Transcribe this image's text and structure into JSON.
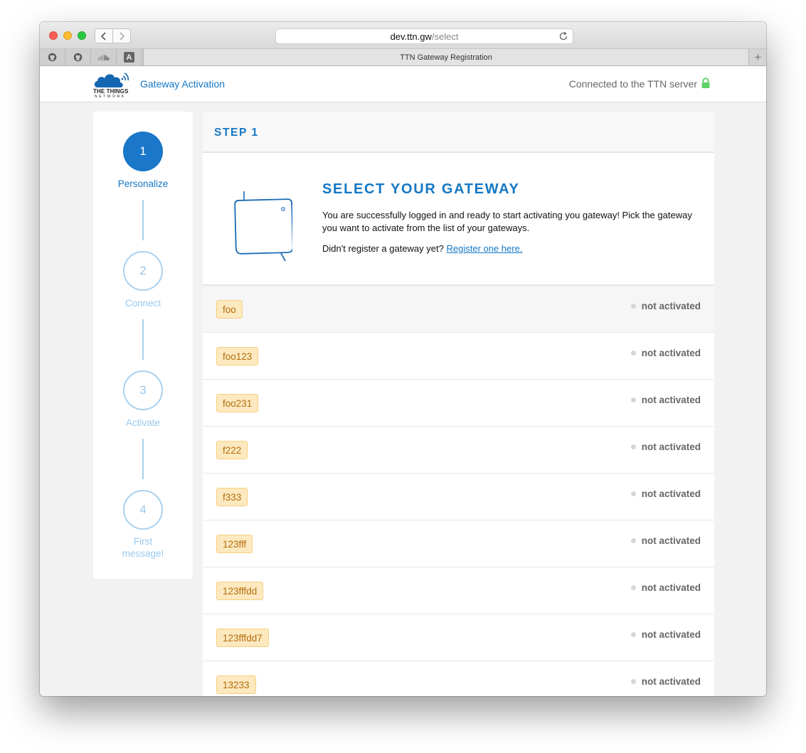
{
  "browser": {
    "url_host": "dev.ttn.gw",
    "url_path": "/select",
    "tab_title": "TTN Gateway Registration",
    "pinned_tabs": [
      "github-icon",
      "github-icon",
      "soundcloud-icon",
      "a-icon"
    ],
    "pinned_a_letter": "A"
  },
  "header": {
    "logo_line1": "THE THINGS",
    "logo_line2": "NETWORK",
    "app_title": "Gateway Activation",
    "connection_status": "Connected to the TTN server",
    "accent_color": "#1577c3",
    "lock_color": "#5fd26a"
  },
  "stepper": {
    "steps": [
      {
        "number": "1",
        "label": "Personalize",
        "active": true
      },
      {
        "number": "2",
        "label": "Connect",
        "active": false
      },
      {
        "number": "3",
        "label": "Activate",
        "active": false
      },
      {
        "number": "4",
        "label_line1": "First",
        "label_line2": "message!",
        "active": false
      }
    ]
  },
  "main": {
    "step_heading": "STEP 1",
    "title": "SELECT YOUR GATEWAY",
    "description": "You are successfully logged in and ready to start activating you gateway! Pick the gateway you want to activate from the list of your gateways.",
    "register_prompt": "Didn't register a gateway yet?",
    "register_link": "Register one here.",
    "gateways": [
      {
        "name": "foo",
        "status": "not activated"
      },
      {
        "name": "foo123",
        "status": "not activated"
      },
      {
        "name": "foo231",
        "status": "not activated"
      },
      {
        "name": "f222",
        "status": "not activated"
      },
      {
        "name": "f333",
        "status": "not activated"
      },
      {
        "name": "123fff",
        "status": "not activated"
      },
      {
        "name": "123fffdd",
        "status": "not activated"
      },
      {
        "name": "123fffdd7",
        "status": "not activated"
      },
      {
        "name": "13233",
        "status": "not activated"
      }
    ]
  }
}
